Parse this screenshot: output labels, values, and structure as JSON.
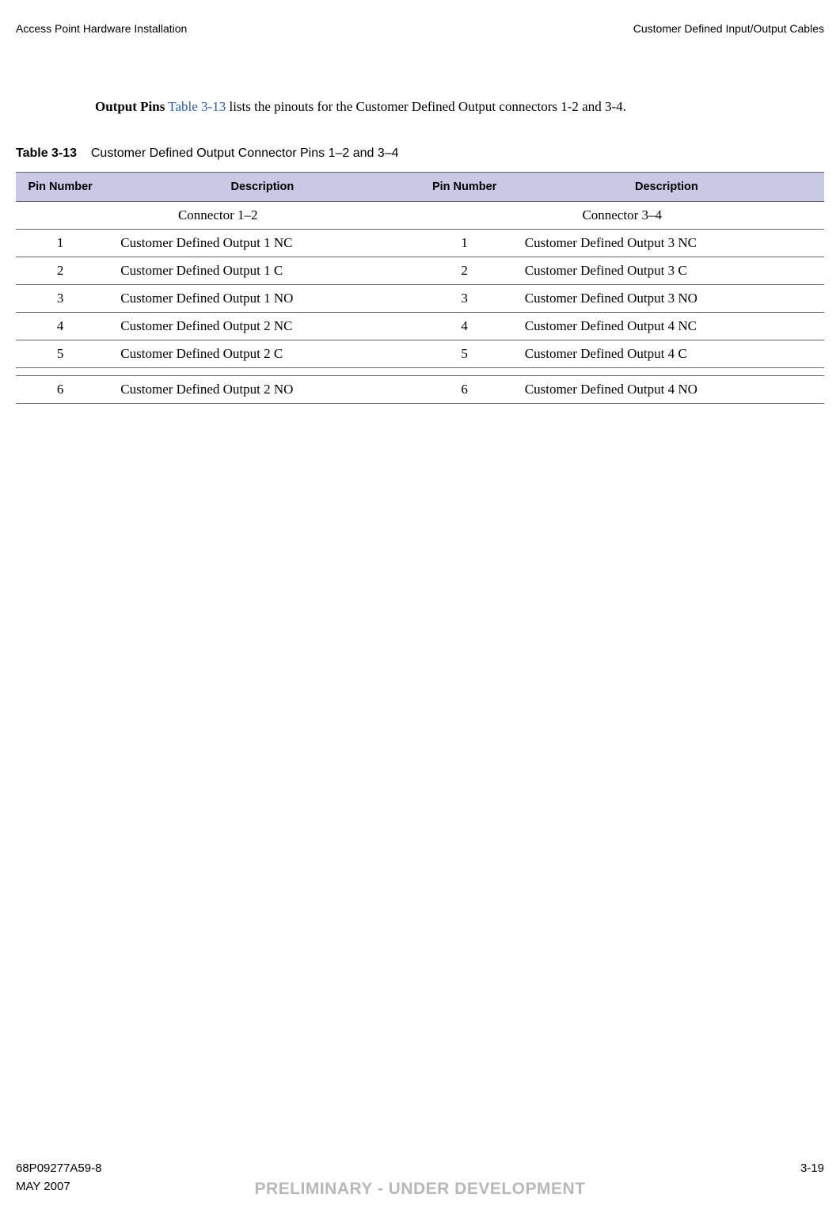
{
  "header": {
    "left": "Access Point Hardware Installation",
    "right": "Customer Defined Input/Output Cables"
  },
  "paragraph": {
    "lead_bold": "Output Pins",
    "link_text": "Table 3-13",
    "rest": " lists the pinouts for the Customer Defined Output connectors 1-2 and 3-4."
  },
  "table": {
    "caption_bold": "Table 3-13",
    "caption_rest": "Customer Defined Output Connector Pins 1–2 and 3–4",
    "headers": [
      "Pin Number",
      "Description",
      "Pin Number",
      "Description"
    ],
    "subheads": [
      "Connector 1–2",
      "Connector 3–4"
    ],
    "rows": [
      [
        "1",
        "Customer Defined Output 1 NC",
        "1",
        "Customer Defined Output 3 NC"
      ],
      [
        "2",
        "Customer Defined Output 1 C",
        "2",
        "Customer Defined Output 3 C"
      ],
      [
        "3",
        "Customer Defined Output 1 NO",
        "3",
        "Customer Defined Output 3 NO"
      ],
      [
        "4",
        "Customer Defined Output 2 NC",
        "4",
        "Customer Defined Output 4 NC"
      ],
      [
        "5",
        "Customer Defined Output 2 C",
        "5",
        "Customer Defined Output 4 C"
      ],
      [
        "6",
        "Customer Defined Output 2 NO",
        "6",
        "Customer Defined Output 4 NO"
      ]
    ]
  },
  "footer": {
    "doc_number": "68P09277A59-8",
    "page_number": "3-19",
    "date": "MAY 2007",
    "watermark": "PRELIMINARY - UNDER DEVELOPMENT"
  }
}
